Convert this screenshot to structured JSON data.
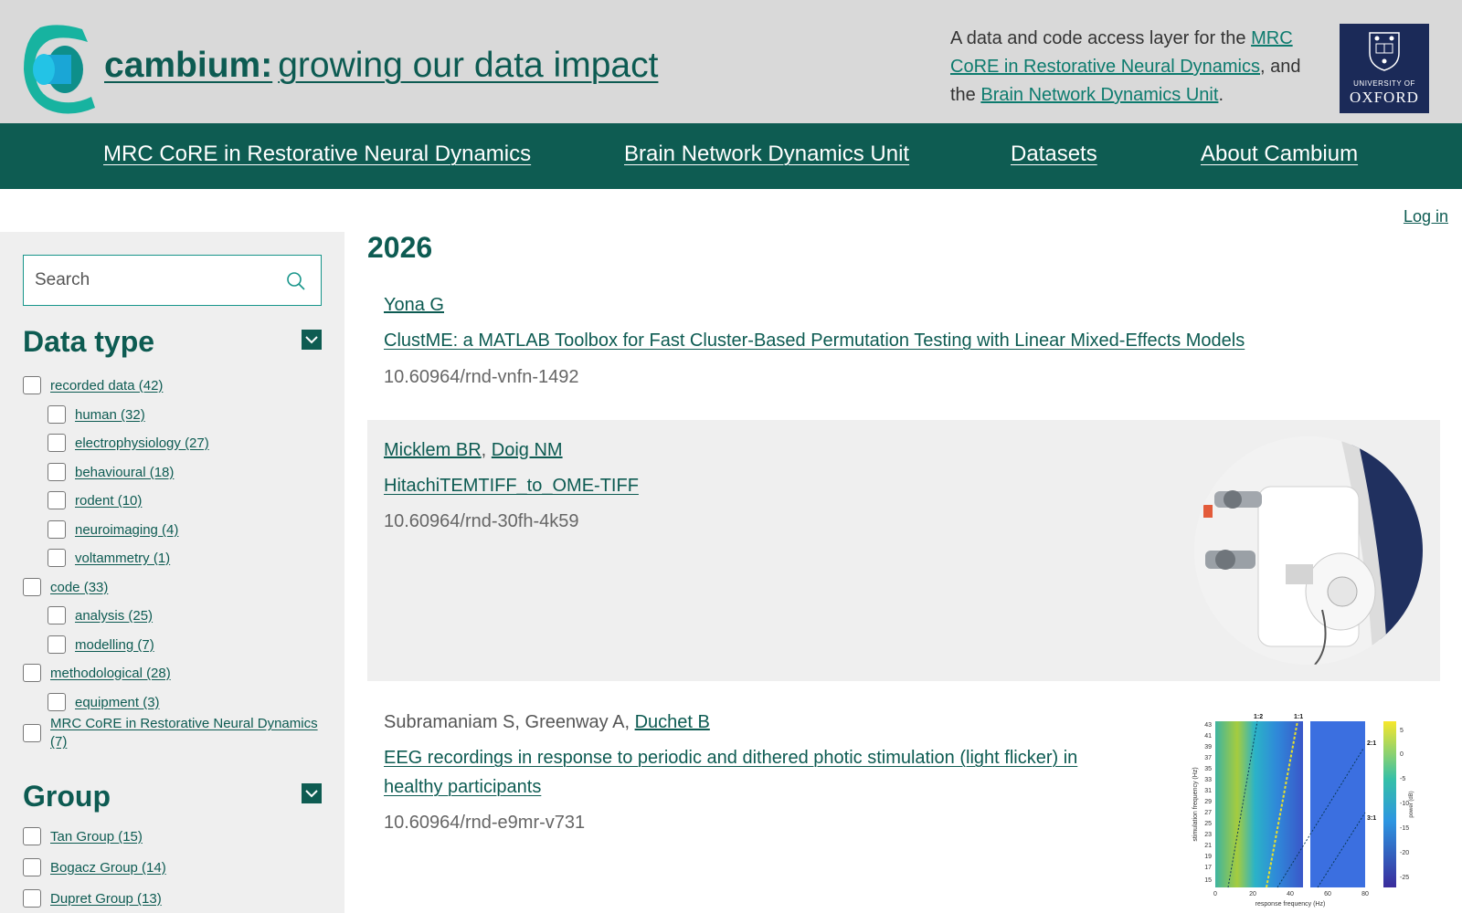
{
  "header": {
    "brand_bold": "cambium:",
    "brand_rest": "growing our data impact",
    "tagline_pre": "A data and code access layer for the ",
    "tagline_link1": "MRC CoRE in Restorative Neural Dynamics",
    "tagline_mid": ", and the ",
    "tagline_link2": "Brain Network Dynamics Unit",
    "tagline_post": ".",
    "oxford_small": "UNIVERSITY OF",
    "oxford_big": "OXFORD"
  },
  "nav": {
    "items": [
      {
        "label": "MRC CoRE in Restorative Neural Dynamics"
      },
      {
        "label": "Brain Network Dynamics Unit"
      },
      {
        "label": "Datasets"
      },
      {
        "label": "About Cambium"
      }
    ]
  },
  "login": "Log in",
  "sidebar": {
    "search_placeholder": "Search",
    "data_type_title": "Data type",
    "data_type": [
      {
        "label": "recorded data (42)"
      },
      {
        "label": "human (32)"
      },
      {
        "label": "electrophysiology (27)"
      },
      {
        "label": "behavioural (18)"
      },
      {
        "label": "rodent (10)"
      },
      {
        "label": "neuroimaging (4)"
      },
      {
        "label": "voltammetry (1)"
      },
      {
        "label": "code (33)"
      },
      {
        "label": "analysis (25)"
      },
      {
        "label": "modelling (7)"
      },
      {
        "label": "methodological (28)"
      },
      {
        "label": "equipment (3)"
      },
      {
        "label": "MRC CoRE in Restorative Neural Dynamics (7)"
      }
    ],
    "group_title": "Group",
    "group": [
      {
        "label": "Tan Group (15)"
      },
      {
        "label": "Bogacz Group (14)"
      },
      {
        "label": "Dupret Group (13)"
      }
    ]
  },
  "main": {
    "year": "2026",
    "records": [
      {
        "authors_plain": "",
        "authors_links": [
          "Yona G"
        ],
        "title": "ClustME: a MATLAB Toolbox for Fast Cluster-Based Permutation Testing with Linear Mixed-Effects Models",
        "doi": "10.60964/rnd-vnfn-1492"
      },
      {
        "authors_plain": "",
        "authors_links": [
          "Micklem BR",
          "Doig NM"
        ],
        "title": "HitachiTEMTIFF_to_OME-TIFF",
        "doi": "10.60964/rnd-30fh-4k59"
      },
      {
        "authors_plain": "Subramaniam S, Greenway A, ",
        "authors_links": [
          "Duchet B"
        ],
        "title": "EEG recordings in response to periodic and dithered photic stimulation (light flicker) in healthy participants",
        "doi": "10.60964/rnd-e9mr-v731"
      }
    ],
    "thumb_chart": {
      "ylabel": "stimulation frequency (Hz)",
      "xlabel": "response frequency (Hz)",
      "yticks": [
        "43",
        "41",
        "39",
        "37",
        "35",
        "33",
        "31",
        "29",
        "27",
        "25",
        "23",
        "21",
        "19",
        "17",
        "15"
      ],
      "xticks": [
        "0",
        "20",
        "40",
        "60",
        "80"
      ],
      "ratio_labels": [
        "1:2",
        "1:1",
        "2:1",
        "3:1"
      ],
      "colorbar_label": "power (dB)",
      "colorbar_ticks": [
        "5",
        "0",
        "-5",
        "-10",
        "-15",
        "-20",
        "-25"
      ]
    }
  }
}
